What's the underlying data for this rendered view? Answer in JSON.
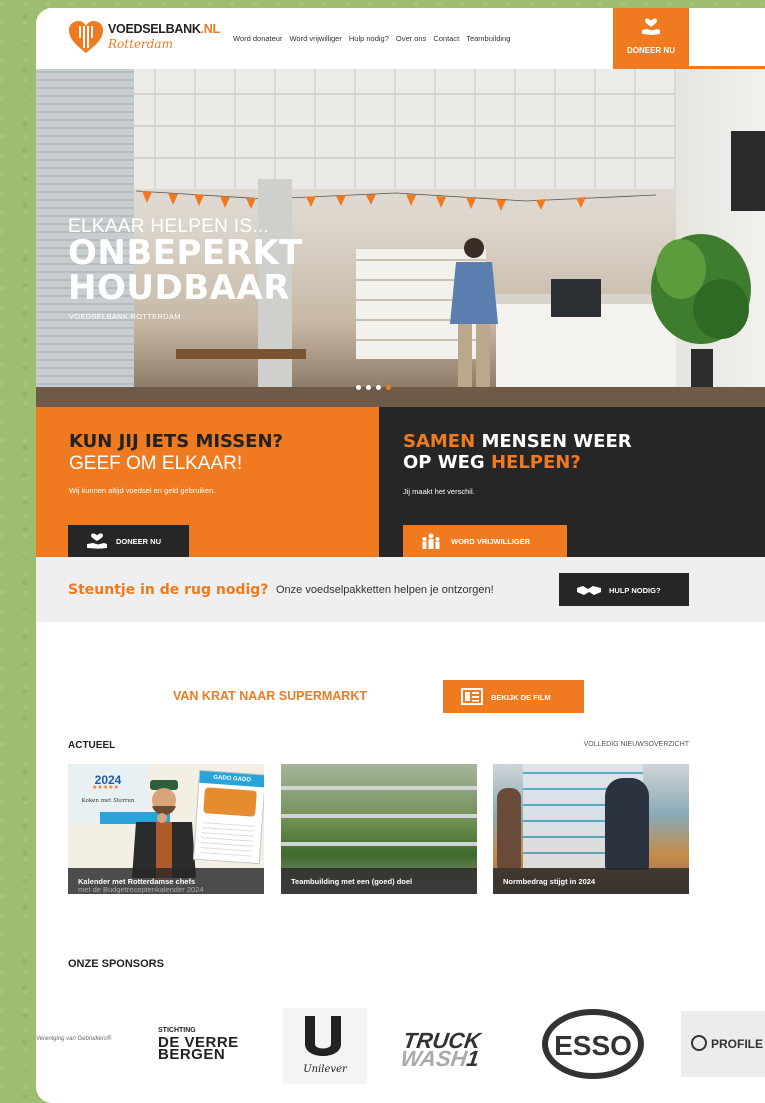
{
  "header": {
    "logo_title": "VOEDSELBANK",
    "logo_tld": ".NL",
    "logo_city": "Rotterdam",
    "nav": [
      "Word donateur",
      "Word vrijwilliger",
      "Hulp nodig?",
      "Over ons",
      "Contact",
      "Teambuilding"
    ],
    "donate_label": "DONEER NU",
    "accent": "#ef7a1f"
  },
  "hero": {
    "kicker": "ELKAAR HELPEN IS...",
    "title_line1": "ONBEPERKT",
    "title_line2": "HOUDBAAR",
    "subtitle": "VOEDSELBANK ROTTERDAM",
    "slides": 4,
    "active_slide": 4
  },
  "promo_left": {
    "title": "KUN JIJ IETS MISSEN?",
    "subtitle": "GEEF OM ELKAAR!",
    "text": "Wij kunnen altijd voedsel en geld gebruiken.",
    "button": "DONEER NU"
  },
  "promo_right": {
    "title_part1": "SAMEN",
    "title_part2": " MENSEN WEER",
    "title_part3": "OP WEG ",
    "title_part4": "HELPEN?",
    "text": "Jij maakt het verschil.",
    "button": "WORD VRIJWILLIGER"
  },
  "help": {
    "lead": "Steuntje in de rug nodig?",
    "rest": "Onze voedselpakketten helpen je ontzorgen!",
    "button": "HULP NODIG?"
  },
  "film": {
    "title": "VAN KRAT NAAR SUPERMARKT",
    "button": "BEKIJK DE FILM"
  },
  "news": {
    "heading": "ACTUEEL",
    "all_link": "VOLLEDIG NIEUWSOVERZICHT",
    "items": [
      {
        "title": "Kalender met Rotterdamse chefs",
        "subtitle": "met de Budgetreceptenkalender 2024",
        "image_year": "2024",
        "image_text": "Koken met Sterren",
        "image_recipe": "GADO GADO"
      },
      {
        "title": "Teambuilding met een (goed) doel"
      },
      {
        "title": "Normbedrag stijgt in 2024"
      }
    ]
  },
  "sponsors": {
    "heading": "ONZE SPONSORS",
    "items": [
      {
        "name": "Vereniging van Gebruikers",
        "text": "Vereniging van Gebruikers®"
      },
      {
        "name": "Stichting De Verre Bergen",
        "line1": "STICHTING",
        "line2": "DE VERRE",
        "line3": "BERGEN"
      },
      {
        "name": "Unilever",
        "text": "Unilever"
      },
      {
        "name": "Truck Wash 1",
        "line1": "TRUCK",
        "line2": "WASH",
        "line3": "1"
      },
      {
        "name": "Esso",
        "text": "ESSO"
      },
      {
        "name": "Profile",
        "text": "PROFILE"
      }
    ]
  }
}
